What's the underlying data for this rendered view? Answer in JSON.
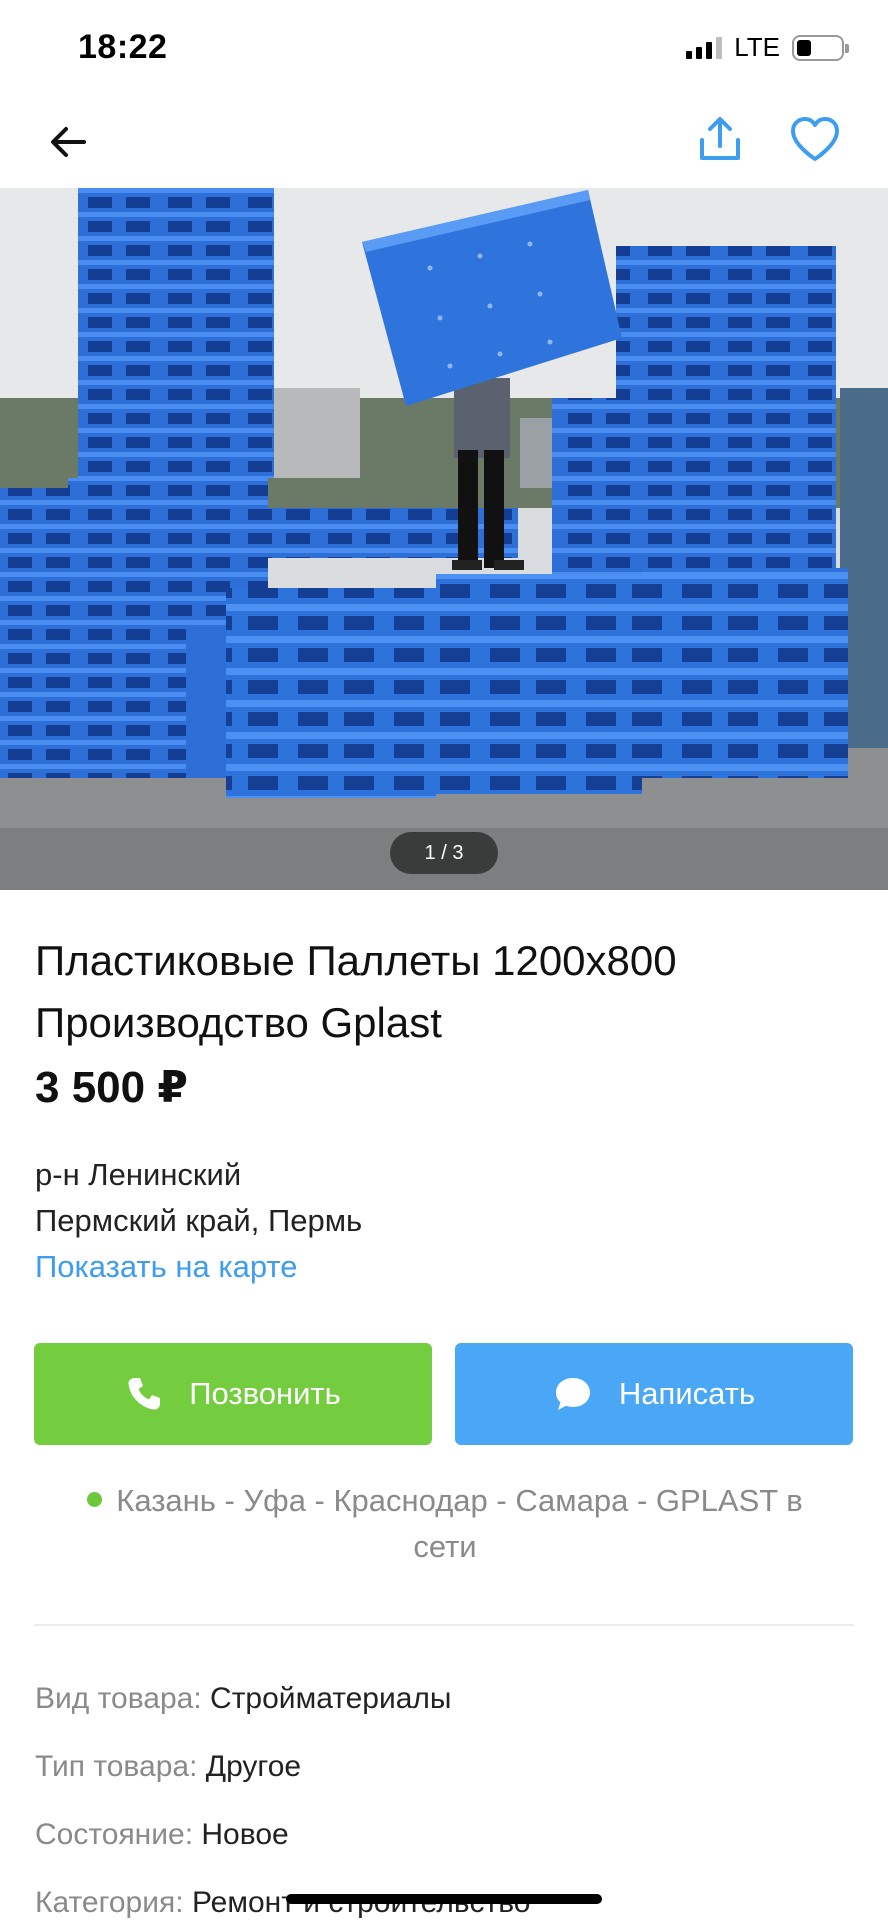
{
  "status_bar": {
    "time": "18:22",
    "network": "LTE"
  },
  "hero": {
    "pager": "1 / 3"
  },
  "listing": {
    "title": "Пластиковые Паллеты 1200х800 Производство Gplast",
    "price": "3 500 ₽",
    "district": "р-н Ленинский",
    "region": "Пермский край, Пермь",
    "map_link": "Показать на карте"
  },
  "actions": {
    "call_label": "Позвонить",
    "write_label": "Написать"
  },
  "seller": {
    "status_text": "Казань - Уфа - Краснодар - Самара - GPLAST в сети"
  },
  "properties": [
    {
      "label": "Вид товара:",
      "value": "Стройматериалы"
    },
    {
      "label": "Тип товара:",
      "value": "Другое"
    },
    {
      "label": "Состояние:",
      "value": "Новое"
    },
    {
      "label": "Категория:",
      "value": "Ремонт и строительство"
    }
  ],
  "colors": {
    "accent_blue": "#49a7f5",
    "call_green": "#74cc3f",
    "link_blue": "#3d9df0",
    "online_green": "#6cc83a",
    "muted": "#8a8a8a"
  },
  "icons": [
    "back-arrow-icon",
    "share-icon",
    "heart-icon",
    "phone-icon",
    "chat-icon"
  ]
}
